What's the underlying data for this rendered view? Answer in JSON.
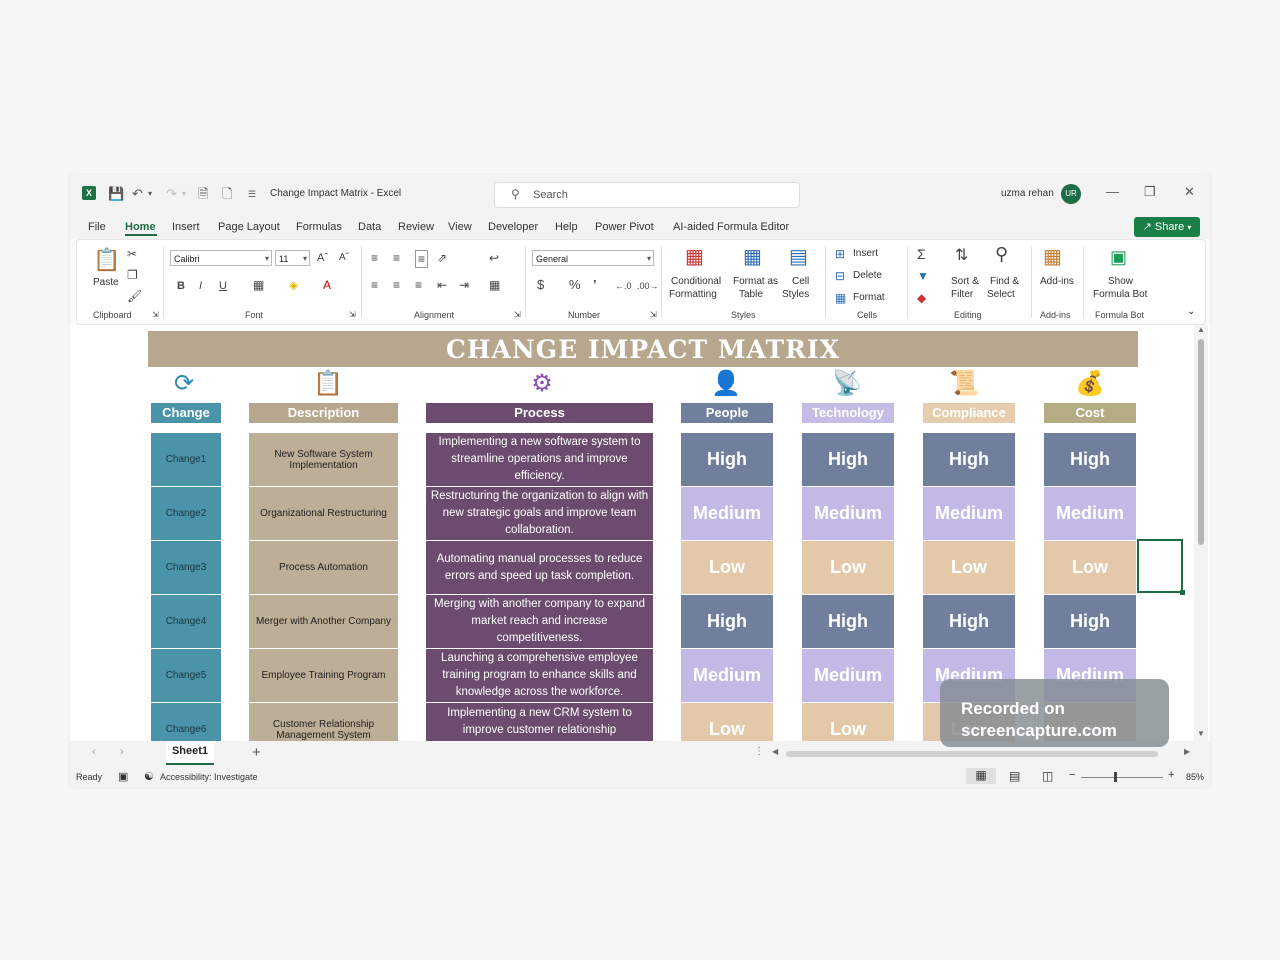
{
  "titlebar": {
    "doc_title": "Change Impact Matrix  -  Excel",
    "search_placeholder": "Search",
    "user_name": "uzma rehan",
    "user_initials": "UR"
  },
  "menu": {
    "items": [
      "File",
      "Home",
      "Insert",
      "Page Layout",
      "Formulas",
      "Data",
      "Review",
      "View",
      "Developer",
      "Help",
      "Power Pivot",
      "AI-aided Formula Editor"
    ],
    "share_label": "Share"
  },
  "ribbon": {
    "paste": "Paste",
    "font_name": "Calibri",
    "font_size": "11",
    "number_format": "General",
    "conditional_formatting": [
      "Conditional",
      "Formatting"
    ],
    "format_as_table": [
      "Format as",
      "Table"
    ],
    "cell_styles": [
      "Cell",
      "Styles"
    ],
    "insert": "Insert",
    "delete": "Delete",
    "format": "Format",
    "sort_filter": [
      "Sort &",
      "Filter"
    ],
    "find_select": [
      "Find &",
      "Select"
    ],
    "addins": "Add-ins",
    "formula_bot": [
      "Show",
      "Formula Bot"
    ],
    "groups": {
      "clipboard": "Clipboard",
      "font": "Font",
      "alignment": "Alignment",
      "number": "Number",
      "styles": "Styles",
      "cells": "Cells",
      "editing": "Editing",
      "addins": "Add-ins",
      "formula_bot": "Formula Bot"
    }
  },
  "sheet": {
    "title": "CHANGE IMPACT MATRIX",
    "headers": {
      "change": "Change",
      "description": "Description",
      "process": "Process",
      "people": "People",
      "technology": "Technology",
      "compliance": "Compliance",
      "cost": "Cost"
    },
    "rows": [
      {
        "change": "Change1",
        "description": "New Software System Implementation",
        "process": "Implementing a new software system to streamline operations and improve efficiency.",
        "level": "High"
      },
      {
        "change": "Change2",
        "description": "Organizational  Restructuring",
        "process": "Restructuring the organization to align with new strategic goals and improve team collaboration.",
        "level": "Medium"
      },
      {
        "change": "Change3",
        "description": "Process Automation",
        "process": "Automating manual processes to reduce errors and speed up task completion.",
        "level": "Low"
      },
      {
        "change": "Change4",
        "description": "Merger with Another Company",
        "process": "Merging with another company to expand market reach and increase competitiveness.",
        "level": "High"
      },
      {
        "change": "Change5",
        "description": "Employee Training Program",
        "process": "Launching a comprehensive employee training program to enhance skills and knowledge across the workforce.",
        "level": "Medium"
      },
      {
        "change": "Change6",
        "description": "Customer Relationship Management System",
        "process": "Implementing a new CRM system to improve customer relationship",
        "level": "Low"
      }
    ],
    "colors": {
      "high": "#6f7f9c",
      "medium": "#c3b9e6",
      "low": "#e3c9a9",
      "people_header": "#6f7f9c",
      "technology_header": "#c6bde6",
      "compliance_header": "#e5cdae",
      "cost_header": "#b4ad84"
    }
  },
  "tabs": {
    "sheet1": "Sheet1",
    "add": "+"
  },
  "status": {
    "ready": "Ready",
    "accessibility": "Accessibility: Investigate",
    "zoom": "85%"
  },
  "watermark": {
    "line1": "Recorded on",
    "line2": "screencapture.com"
  }
}
